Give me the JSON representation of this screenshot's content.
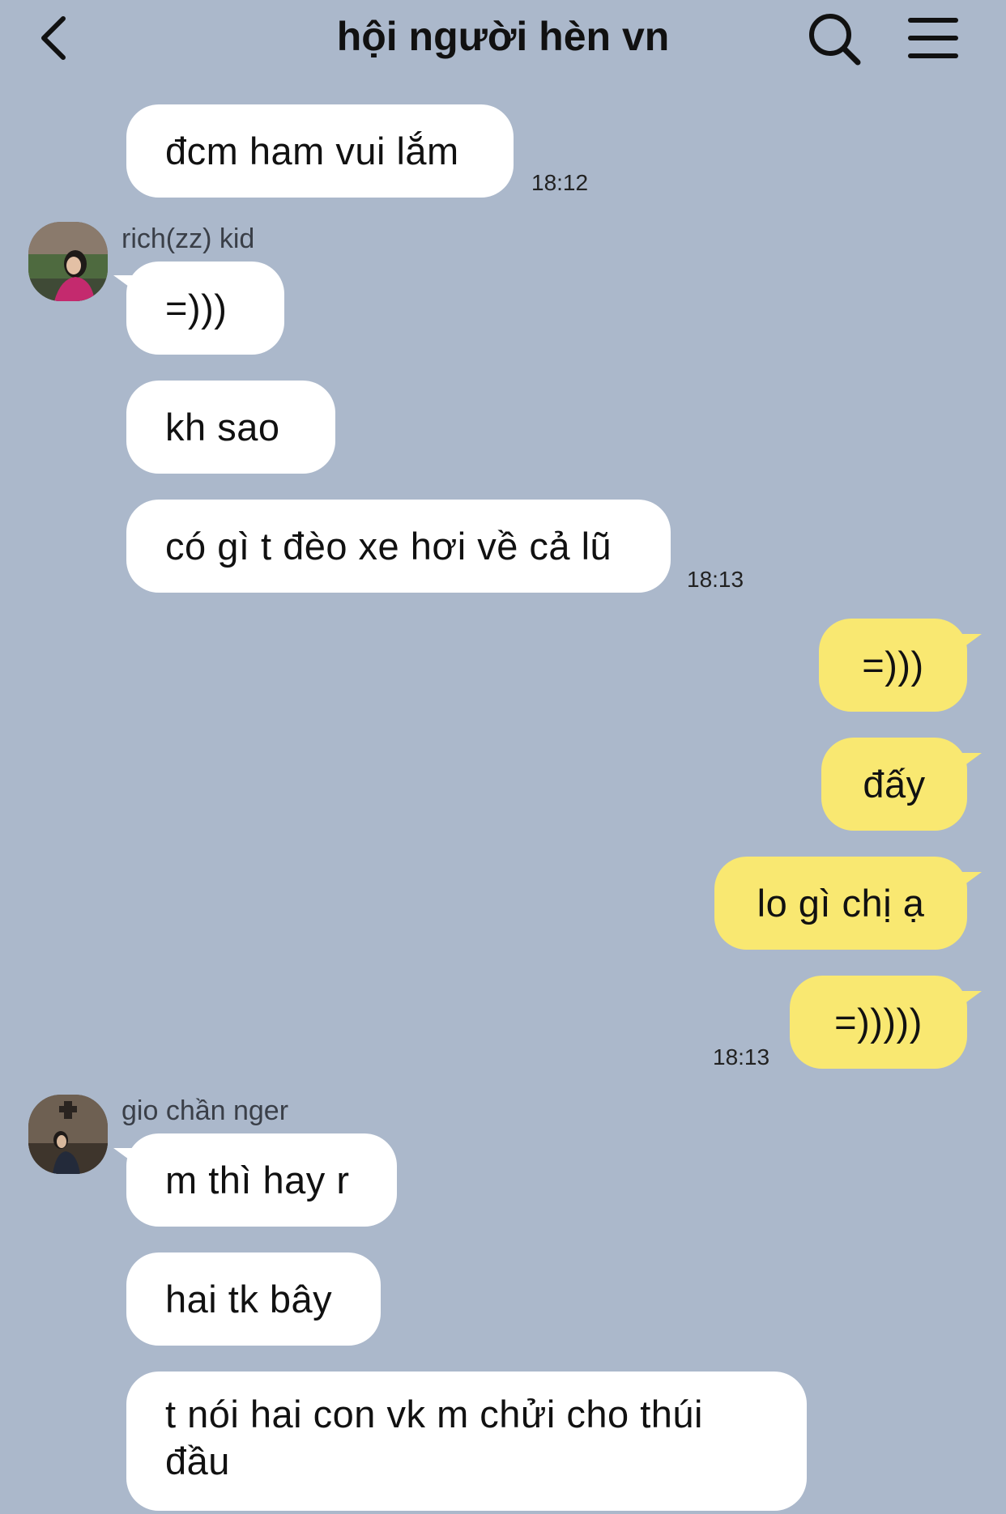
{
  "header": {
    "title": "hội người hèn vn",
    "back_icon": "chevron-left-icon",
    "search_icon": "search-icon",
    "menu_icon": "hamburger-menu-icon"
  },
  "colors": {
    "background": "#abb8cb",
    "incoming_bubble": "#ffffff",
    "outgoing_bubble": "#f9e871"
  },
  "messages": [
    {
      "text": "đcm ham vui lắm",
      "time": "18:12"
    },
    {
      "sender": "rich(zz) kid",
      "text": "=)))"
    },
    {
      "text": "kh sao"
    },
    {
      "text": "có gì t đèo xe hơi về cả lũ",
      "time": "18:13"
    },
    {
      "text": "=)))"
    },
    {
      "text": "đấy"
    },
    {
      "text": "lo gì chị ạ"
    },
    {
      "text": "=)))))",
      "time": "18:13"
    },
    {
      "sender": "gio chần nger",
      "text": "m thì hay r"
    },
    {
      "text": "hai tk bây"
    },
    {
      "text": "t nói hai con vk m chửi cho thúi đầu"
    }
  ]
}
